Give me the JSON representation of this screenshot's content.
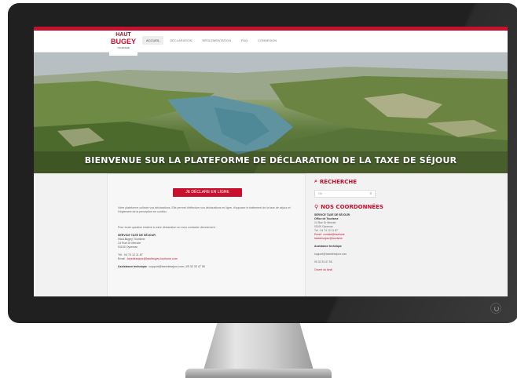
{
  "site": {
    "logo": {
      "line1": "HAUT",
      "line2": "BUGEY",
      "line3": "TOURISME"
    },
    "nav": [
      "ACCUEIL",
      "DÉCLARATION",
      "RÉGLEMENTATION",
      "FAQ",
      "CONNEXION"
    ],
    "hero_title": "BIENVENUE SUR LA PLATEFORME DE DÉCLARATION DE LA TAXE DE SÉJOUR",
    "declare_button": "JE DÉCLARE EN LIGNE",
    "intro_paragraph": "Votre plateforme collecte vos déclarations. Elle permet d'effectuer vos déclarations en ligne, d'opposer le traitement de la taxe de séjour et l'règlement de la perception en continu.",
    "help_line": "Pour toute question relative à votre déclaration ou vous contacter directement :",
    "contact": {
      "service": "SERVICE TAXE DE SÉJOUR",
      "org": "Haut-Bugey Tourisme",
      "address1": "14 Rue Dr Mercier",
      "address2": "01100 Oyonnax",
      "tel": "Tél : 04 74 12 11 87",
      "email_label": "Email : ",
      "email": "taxedesejour@hautbugey-tourisme.com",
      "tech_label": "Assistance technique : ",
      "tech": "support@taxedesejour.com | 05 32 33 47 55"
    },
    "sidebar": {
      "search_title": "RECHERCHE",
      "search_placeholder": "Ok",
      "coords_title": "NOS COORDONNÉES",
      "coord_lines": [
        "SERVICE TAXE DE SÉJOUR",
        "Office de Tourisme",
        "14 Rue Dr Mercier",
        "01100 Oyonnax",
        "Tél : 04 74 12 11 87",
        "Email : contact@tourisme",
        "taxedesejour@tourisme"
      ],
      "tech_title": "Assistance technique",
      "tech_lines": [
        "support@taxedesejour.com",
        "05 32 33 47 55",
        "Ouvert du lundi"
      ]
    }
  },
  "colors": {
    "accent": "#c8102e",
    "monitor": "#202020"
  }
}
